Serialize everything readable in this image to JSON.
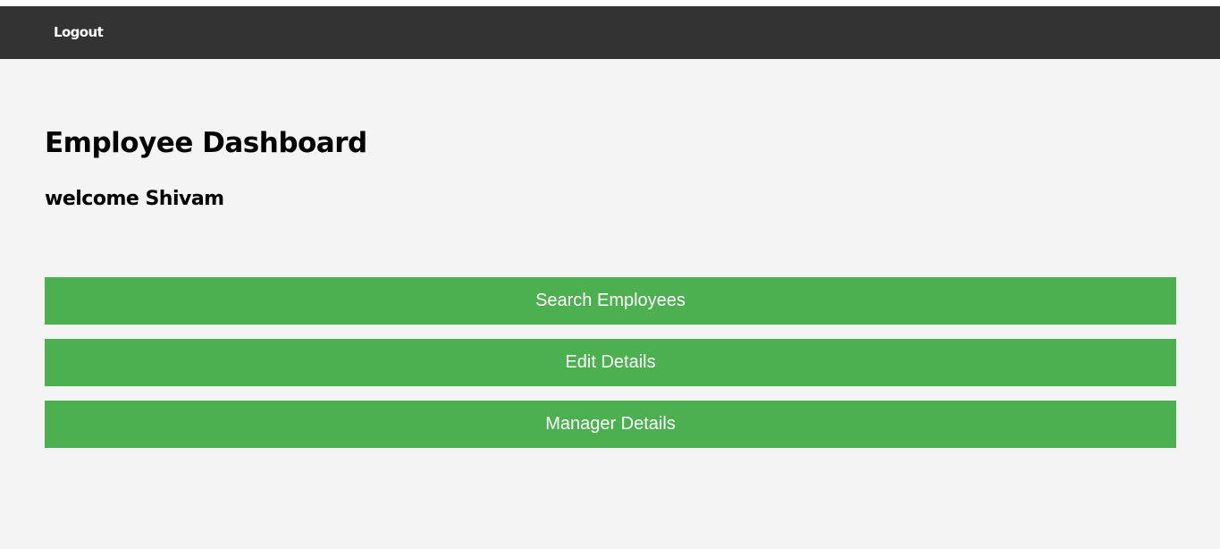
{
  "navbar": {
    "logout_label": "Logout"
  },
  "dashboard": {
    "title": "Employee Dashboard",
    "welcome": "welcome Shivam"
  },
  "actions": {
    "search_employees": "Search Employees",
    "edit_details": "Edit Details",
    "manager_details": "Manager Details"
  },
  "colors": {
    "navbar_background": "#333333",
    "page_background": "#f4f4f4",
    "button_background": "#4caf50",
    "button_text": "#ffffff"
  }
}
